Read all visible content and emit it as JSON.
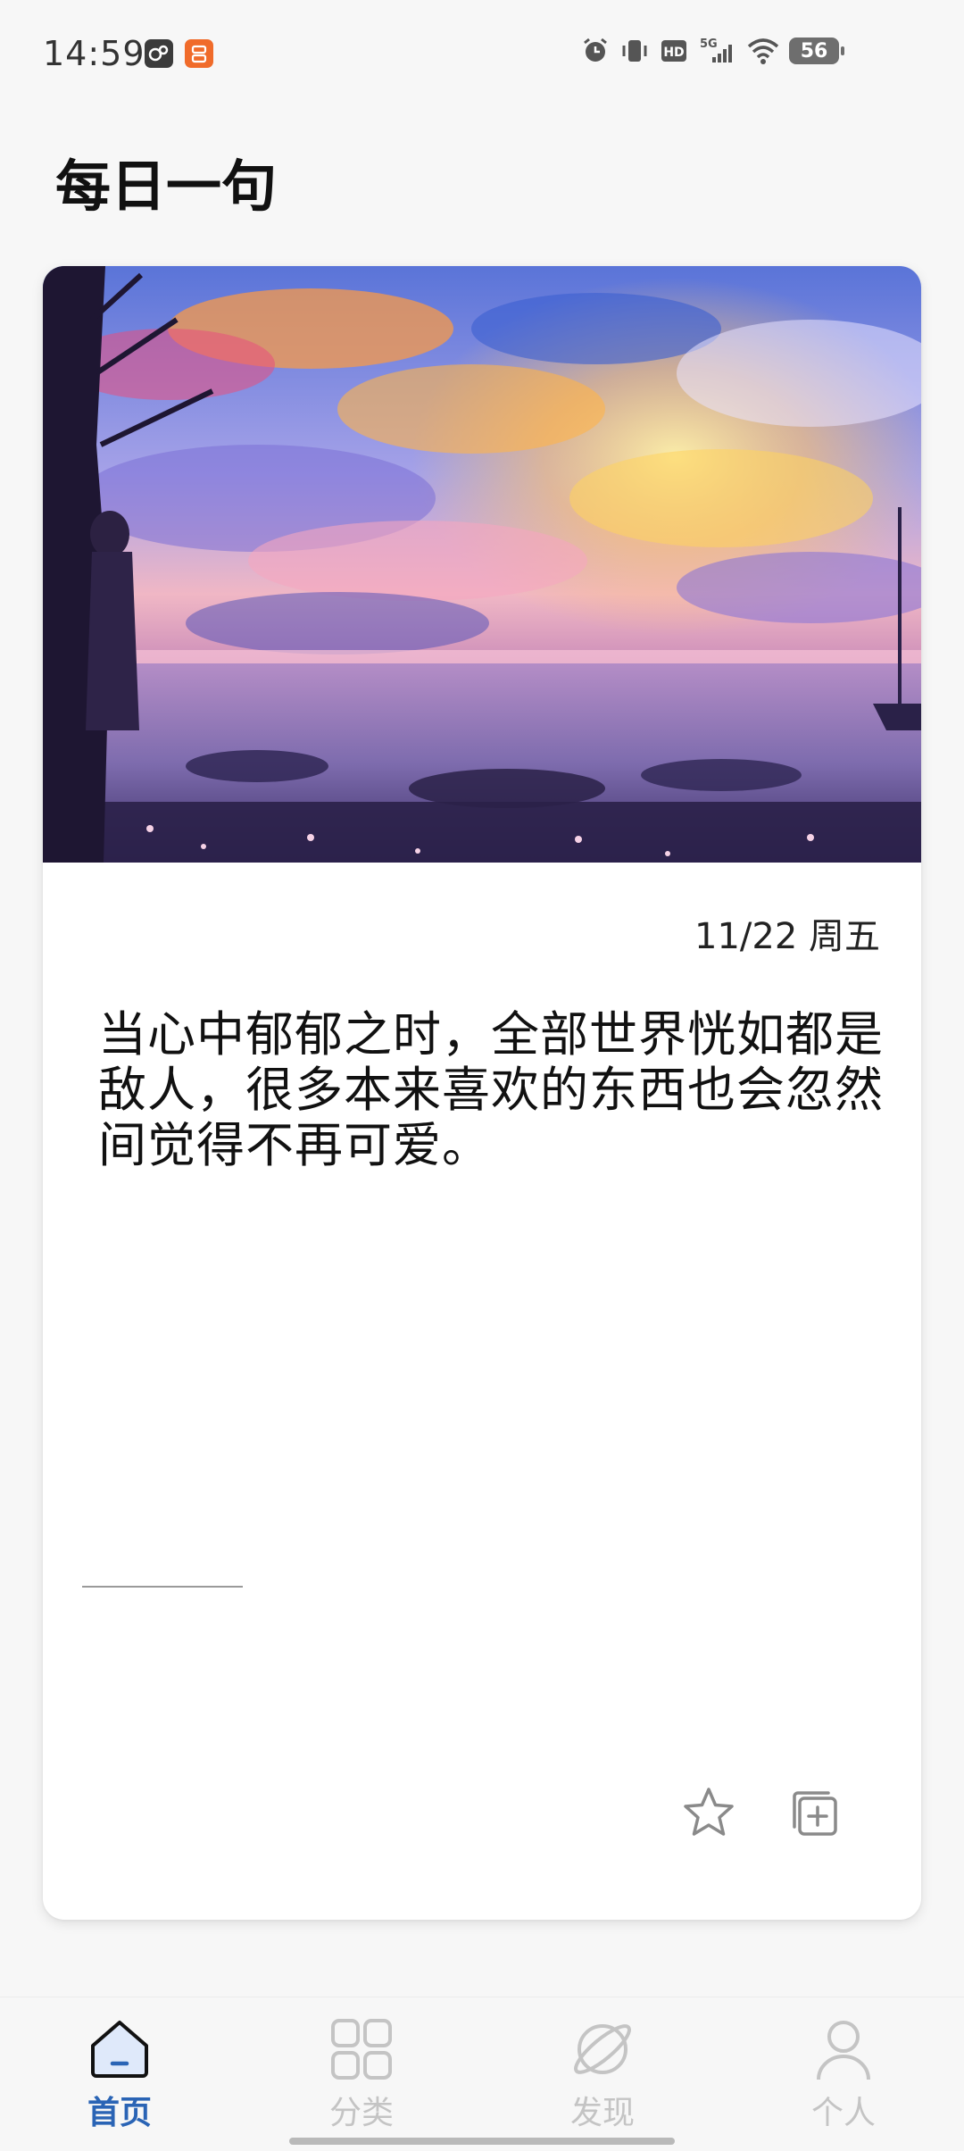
{
  "status_bar": {
    "time": "14:59",
    "battery_level": "56",
    "network": "5G",
    "hd_label": "HD",
    "icons": [
      "game-app-icon",
      "shop-app-icon",
      "alarm-icon",
      "vibrate-icon",
      "hd-icon",
      "signal-5g-icon",
      "wifi-icon",
      "battery-icon"
    ]
  },
  "page": {
    "title": "每日一句"
  },
  "card": {
    "image": "anime-sunset-sea-landscape",
    "date": "11/22 周五",
    "quote": "当心中郁郁之时，全部世界恍如都是敌人，很多本来喜欢的东西也会忽然间觉得不再可爱。",
    "actions": {
      "favorite_icon": "star-outline-icon",
      "add_icon": "add-copy-icon"
    }
  },
  "bottom_nav": {
    "items": [
      {
        "label": "首页",
        "icon": "home-icon",
        "active": true
      },
      {
        "label": "分类",
        "icon": "grid-icon",
        "active": false
      },
      {
        "label": "发现",
        "icon": "planet-icon",
        "active": false
      },
      {
        "label": "个人",
        "icon": "person-icon",
        "active": false
      }
    ]
  },
  "colors": {
    "background": "#f7f7f7",
    "active": "#2a64b5",
    "inactive": "#c4c4c4",
    "card": "#ffffff"
  }
}
